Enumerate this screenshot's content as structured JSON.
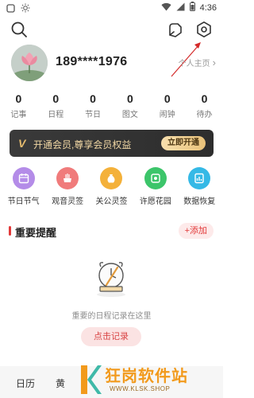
{
  "status_bar": {
    "time": "4:36",
    "icons": [
      "app-notification-icon",
      "brightness-icon",
      "wifi-icon",
      "signal-icon",
      "battery-icon"
    ]
  },
  "top_bar": {
    "icons": [
      "search-icon",
      "notes-icon",
      "settings-icon"
    ]
  },
  "profile": {
    "username": "189****1976",
    "homepage_label": "个人主页",
    "homepage_arrow": "›"
  },
  "stats": [
    {
      "value": "0",
      "label": "记事"
    },
    {
      "value": "0",
      "label": "日程"
    },
    {
      "value": "0",
      "label": "节日"
    },
    {
      "value": "0",
      "label": "图文"
    },
    {
      "value": "0",
      "label": "闹钟"
    },
    {
      "value": "0",
      "label": "待办"
    }
  ],
  "vip": {
    "badge": "V",
    "text": "开通会员,尊享会员权益",
    "button": "立即开通"
  },
  "features": [
    {
      "label": "节日节气",
      "icon": "calendar-icon",
      "color": "#b48ce8"
    },
    {
      "label": "观音灵签",
      "icon": "incense-icon",
      "color": "#f07b7b"
    },
    {
      "label": "关公灵签",
      "icon": "fortune-bag-icon",
      "color": "#f4b13a"
    },
    {
      "label": "许愿花园",
      "icon": "wish-garden-icon",
      "color": "#3cc56a"
    },
    {
      "label": "数据恢复",
      "icon": "data-restore-icon",
      "color": "#35b9e6"
    }
  ],
  "reminders": {
    "title": "重要提醒",
    "add_label": "+添加",
    "empty_text": "重要的日程记录在这里",
    "record_button": "点击记录"
  },
  "tabs": [
    {
      "label": "日历"
    },
    {
      "label": "黄"
    }
  ],
  "watermark": {
    "main": "狂岗软件站",
    "sub": "WWW.KLSK.SHOP"
  },
  "colors": {
    "accent_red": "#e23a3a",
    "vip_gold": "#e9c27a",
    "watermark_orange": "#f29a1c"
  }
}
